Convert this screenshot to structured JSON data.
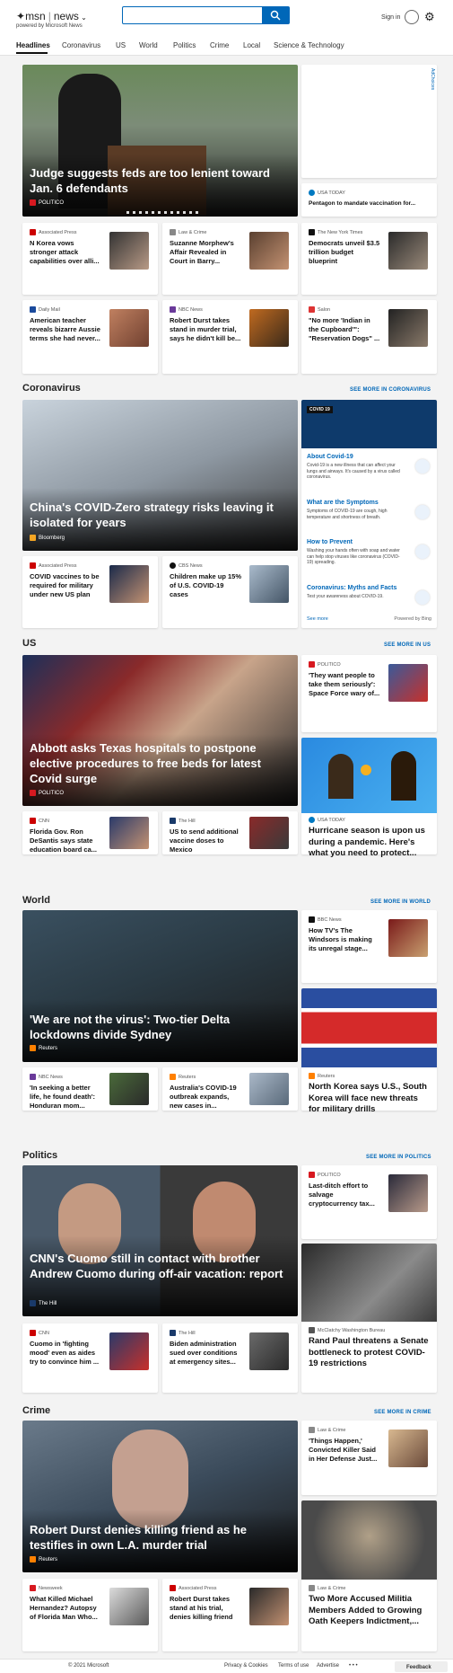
{
  "header": {
    "logo": "msn",
    "section": "news",
    "powered": "powered by Microsoft News",
    "search_value": "",
    "sign_in": "Sign in"
  },
  "nav": [
    "Headlines",
    "Coronavirus",
    "US",
    "World",
    "Politics",
    "Crime",
    "Local",
    "Science & Technology"
  ],
  "ad_label": "AdChoices",
  "see_more": {
    "coronavirus": "SEE MORE IN CORONAVIRUS",
    "us": "SEE MORE IN US",
    "world": "SEE MORE IN WORLD",
    "politics": "SEE MORE IN POLITICS",
    "crime": "SEE MORE IN CRIME"
  },
  "sections": {
    "coronavirus": "Coronavirus",
    "us": "US",
    "world": "World",
    "politics": "Politics",
    "crime": "Crime"
  },
  "headlines": {
    "hero": {
      "title": "Judge suggests feds are too lenient toward Jan. 6 defendants",
      "source": "POLITICO"
    },
    "side": {
      "source": "USA TODAY",
      "title": "Pentagon to mandate vaccination for..."
    },
    "cards": [
      {
        "source": "Associated Press",
        "title": "N Korea vows stronger attack capabilities over alli..."
      },
      {
        "source": "Law & Crime",
        "title": "Suzanne Morphew's Affair Revealed in Court in Barry..."
      },
      {
        "source": "The New York Times",
        "title": "Democrats unveil $3.5 trillion budget blueprint"
      },
      {
        "source": "Daily Mail",
        "title": "American teacher reveals bizarre Aussie terms she had never..."
      },
      {
        "source": "NBC News",
        "title": "Robert Durst takes stand in murder trial, says he didn't kill be..."
      },
      {
        "source": "Salon",
        "title": "\"No more 'Indian in the Cupboard'\": \"Reservation Dogs\" ..."
      }
    ]
  },
  "coronavirus": {
    "hero": {
      "title": "China's COVID-Zero strategy risks leaving it isolated for years",
      "source": "Bloomberg"
    },
    "cards": [
      {
        "source": "Associated Press",
        "title": "COVID vaccines to be required for military under new US plan"
      },
      {
        "source": "CBS News",
        "title": "Children make up 15% of U.S. COVID-19 cases"
      }
    ],
    "info": {
      "badge": "COVID 19",
      "items": [
        {
          "title": "About Covid-19",
          "desc": "Covid-19 is a new illness that can affect your lungs and airways. It's caused by a virus called coronavirus."
        },
        {
          "title": "What are the Symptoms",
          "desc": "Symptoms of COVID-19 are cough, high temperature and shortness of breath."
        },
        {
          "title": "How to Prevent",
          "desc": "Washing your hands often with soap and water can help stop viruses like coronavirus (COVID-19) spreading."
        },
        {
          "title": "Coronavirus: Myths and Facts",
          "desc": "Test your awareness about COVID-19."
        }
      ],
      "see_more": "See more",
      "powered": "Powered by Bing"
    }
  },
  "us": {
    "hero": {
      "title": "Abbott asks Texas hospitals to postpone elective procedures to free beds for latest Covid surge",
      "source": "POLITICO"
    },
    "side": {
      "source": "POLITICO",
      "title": "'They want people to take them seriously': Space Force wary of..."
    },
    "big": {
      "source": "USA TODAY",
      "title": "Hurricane season is upon us during a pandemic. Here's what you need to protect..."
    },
    "cards": [
      {
        "source": "CNN",
        "title": "Florida Gov. Ron DeSantis says state education board ca..."
      },
      {
        "source": "The Hill",
        "title": "US to send additional vaccine doses to Mexico"
      }
    ]
  },
  "world": {
    "hero": {
      "title": "'We are not the virus': Two-tier Delta lockdowns divide Sydney",
      "source": "Reuters"
    },
    "side": {
      "source": "BBC News",
      "title": "How TV's The Windsors is making its unregal stage..."
    },
    "big": {
      "source": "Reuters",
      "title": "North Korea says U.S., South Korea will face new threats for military drills"
    },
    "cards": [
      {
        "source": "NBC News",
        "title": "'In seeking a better life, he found death': Honduran mom..."
      },
      {
        "source": "Reuters",
        "title": "Australia's COVID-19 outbreak expands, new cases in..."
      }
    ]
  },
  "politics": {
    "hero": {
      "title": "CNN's Cuomo still in contact with brother Andrew Cuomo during off-air vacation: report",
      "source": "The Hill"
    },
    "side": {
      "source": "POLITICO",
      "title": "Last-ditch effort to salvage cryptocurrency tax..."
    },
    "big": {
      "source": "McClatchy Washington Bureau",
      "title": "Rand Paul threatens a Senate bottleneck to protest COVID-19 restrictions"
    },
    "cards": [
      {
        "source": "CNN",
        "title": "Cuomo in 'fighting mood' even as aides try to convince him ..."
      },
      {
        "source": "The Hill",
        "title": "Biden administration sued over conditions at emergency sites..."
      }
    ]
  },
  "crime": {
    "hero": {
      "title": "Robert Durst denies killing friend as he testifies in own L.A. murder trial",
      "source": "Reuters"
    },
    "side": {
      "source": "Law & Crime",
      "title": "'Things Happen,' Convicted Killer Said in Her Defense Just..."
    },
    "big": {
      "source": "Law & Crime",
      "title": "Two More Accused Militia Members Added to Growing Oath Keepers Indictment,..."
    },
    "cards": [
      {
        "source": "Newsweek",
        "title": "What Killed Michael Hernandez? Autopsy of Florida Man Who..."
      },
      {
        "source": "Associated Press",
        "title": "Robert Durst takes stand at his trial, denies killing friend"
      }
    ]
  },
  "footer": {
    "copyright": "© 2021 Microsoft",
    "privacy": "Privacy & Cookies",
    "terms": "Terms of use",
    "advertise": "Advertise",
    "more": "• • •",
    "feedback": "Feedback"
  }
}
